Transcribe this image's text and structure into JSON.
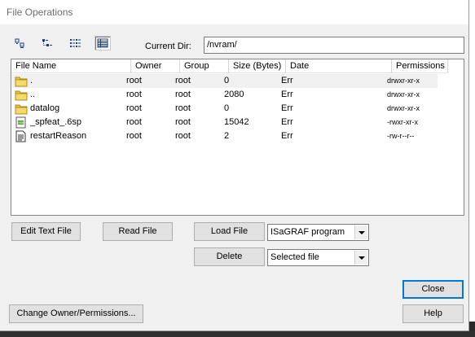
{
  "window": {
    "title": "File Operations"
  },
  "toolbar": {
    "views": [
      {
        "name": "large-icons-view",
        "active": false
      },
      {
        "name": "small-icons-view",
        "active": false
      },
      {
        "name": "list-view",
        "active": false
      },
      {
        "name": "details-view",
        "active": true
      }
    ]
  },
  "current_dir": {
    "label": "Current Dir:",
    "value": "/nvram/"
  },
  "file_list": {
    "columns": [
      "File Name",
      "Owner",
      "Group",
      "Size (Bytes)",
      "Date",
      "Permissions"
    ],
    "rows": [
      {
        "icon": "folder-icon",
        "name": ".",
        "owner": "root",
        "group": "root",
        "size": "0",
        "date": "Err",
        "permissions": "drwxr-xr-x",
        "selected": true
      },
      {
        "icon": "folder-icon",
        "name": "..",
        "owner": "root",
        "group": "root",
        "size": "2080",
        "date": "Err",
        "permissions": "drwxr-xr-x",
        "selected": false
      },
      {
        "icon": "folder-icon",
        "name": "datalog",
        "owner": "root",
        "group": "root",
        "size": "0",
        "date": "Err",
        "permissions": "drwxr-xr-x",
        "selected": false
      },
      {
        "icon": "executable-icon",
        "name": "_spfeat_.6sp",
        "owner": "root",
        "group": "root",
        "size": "15042",
        "date": "Err",
        "permissions": "-rwxr-xr-x",
        "selected": false
      },
      {
        "icon": "text-file-icon",
        "name": "restartReason",
        "owner": "root",
        "group": "root",
        "size": "2",
        "date": "Err",
        "permissions": "-rw-r--r--",
        "selected": false
      }
    ]
  },
  "buttons": {
    "edit_text_file": "Edit Text File",
    "read_file": "Read File",
    "load_file": "Load File",
    "delete": "Delete",
    "close": "Close",
    "change_owner": "Change Owner/Permissions...",
    "help": "Help"
  },
  "load_type_select": {
    "value": "ISaGRAF program"
  },
  "delete_scope_select": {
    "value": "Selected file"
  }
}
